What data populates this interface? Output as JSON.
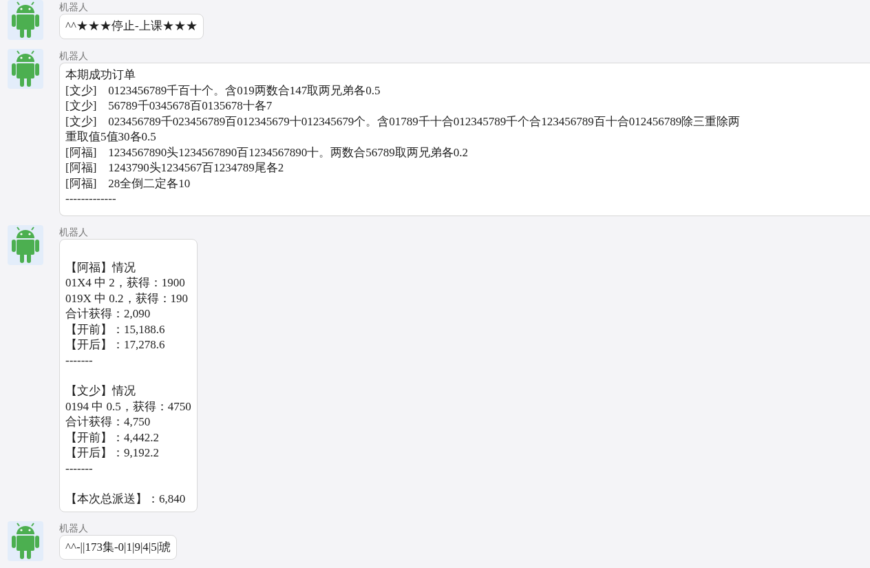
{
  "messages": [
    {
      "sender": "机器人",
      "kind": "plain",
      "paragraphs": [
        [
          "^^★★★停止-上课★★★"
        ]
      ]
    },
    {
      "sender": "机器人",
      "kind": "plain",
      "paragraphs": [
        [
          "本期成功订单",
          "[文少]    0123456789千百十个。含019两数合147取两兄弟各0.5",
          "[文少]    56789千0345678百0135678十各7",
          "[文少]    023456789千023456789百012345679十012345679个。含01789千十合012345789千个合123456789百十合012456789除三重除两",
          "重取值5值30各0.5",
          "[阿福]    1234567890头1234567890百1234567890十。两数合56789取两兄弟各0.2",
          "[阿福]    1243790头1234567百1234789尾各2",
          "[阿福]    28全倒二定各10",
          "-------------"
        ]
      ]
    },
    {
      "sender": "机器人",
      "kind": "report",
      "paragraphs": [
        [
          "【阿福】情况",
          "01X4 中 2，获得：1900",
          "019X 中 0.2，获得：190",
          "合计获得：2,090",
          "【开前】：15,188.6",
          "【开后】：17,278.6",
          "-------"
        ],
        [
          "【文少】情况",
          "0194 中 0.5，获得：4750",
          "合计获得：4,750",
          "【开前】：4,442.2",
          "【开后】：9,192.2",
          "-------"
        ],
        [
          "【本次总派送】：6,840"
        ]
      ]
    },
    {
      "sender": "机器人",
      "kind": "plain",
      "paragraphs": [
        [
          "^^-||173集-0|1|9|4|5|琥"
        ]
      ]
    }
  ]
}
